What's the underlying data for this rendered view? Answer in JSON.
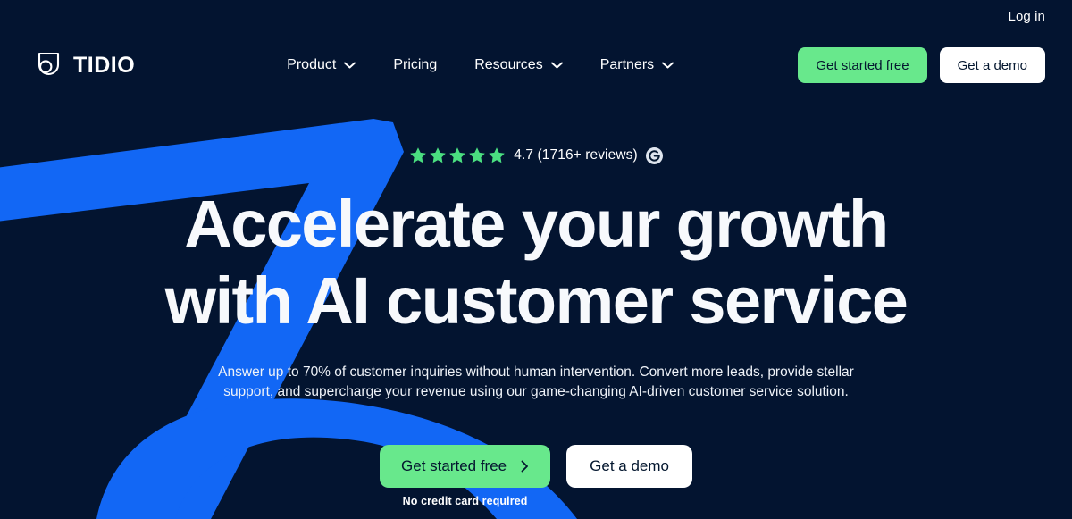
{
  "brand": {
    "name": "TIDIO",
    "logo_icon": "tidio-droplet-icon"
  },
  "utility": {
    "login_label": "Log in"
  },
  "nav": {
    "items": [
      {
        "label": "Product",
        "has_dropdown": true,
        "icon": "chevron-down-icon"
      },
      {
        "label": "Pricing",
        "has_dropdown": false,
        "icon": ""
      },
      {
        "label": "Resources",
        "has_dropdown": true,
        "icon": "chevron-down-icon"
      },
      {
        "label": "Partners",
        "has_dropdown": true,
        "icon": "chevron-down-icon"
      }
    ],
    "actions": {
      "primary_label": "Get started free",
      "secondary_label": "Get a demo"
    }
  },
  "hero": {
    "rating": {
      "stars_filled": 5,
      "stars_total": 5,
      "score": "4.7",
      "text": "4.7 (1716+ reviews)",
      "source_icon": "g2-logo-icon"
    },
    "title_line1": "Accelerate your growth",
    "title_line2": "with AI customer service",
    "subtitle": "Answer up to 70% of customer inquiries without human intervention. Convert more leads, provide stellar support, and supercharge your revenue using our game-changing AI-driven customer service solution.",
    "cta": {
      "primary_label": "Get started free",
      "primary_icon": "chevron-right-icon",
      "primary_note": "No credit card required",
      "secondary_label": "Get a demo"
    }
  },
  "colors": {
    "background": "#031430",
    "accent_blue": "#1267f5",
    "accent_green": "#68e88c",
    "text_light": "#f7f9fc",
    "button_white": "#ffffff",
    "button_text_dark": "#04172f",
    "star_green": "#4ade80"
  }
}
